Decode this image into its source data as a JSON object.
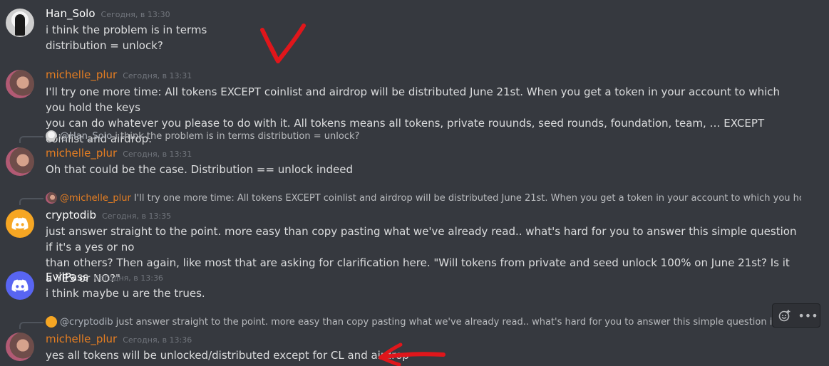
{
  "messages": [
    {
      "author": "Han_Solo",
      "timestamp": "Сегодня, в 13:30",
      "lines": [
        "i think the problem is in terms",
        "distribution = unlock?"
      ],
      "avatar_icon": "han-solo-avatar"
    },
    {
      "author": "michelle_plur",
      "timestamp": "Сегодня, в 13:31",
      "lines": [
        "I'll try one more time: All tokens EXCEPT coinlist and airdrop will be distributed June 21st. When you get a token in your account to which you hold the keys",
        "you can do whatever you please to do with it. All tokens means all tokens, private rouunds, seed rounds, foundation, team, … EXCEPT coinlist and airdrop."
      ],
      "avatar_icon": "michelle-avatar"
    },
    {
      "reply": {
        "mention": "@Han_Solo",
        "text": "i think the problem is in terms distribution = unlock?"
      },
      "author": "michelle_plur",
      "timestamp": "Сегодня, в 13:31",
      "lines": [
        "Oh that could be the case. Distribution == unlock indeed"
      ],
      "avatar_icon": "michelle-avatar"
    },
    {
      "reply": {
        "mention": "@michelle_plur",
        "text": "I'll try one more time: All tokens EXCEPT coinlist and airdrop will be distributed June 21st. When you get a token in your account to which you hold the keys you …"
      },
      "author": "cryptodib",
      "timestamp": "Сегодня, в 13:35",
      "lines": [
        "just answer straight to the point. more easy than copy pasting what we've already read.. what's hard for you to answer this simple question if it's a yes or no",
        "than others? Then again, like most that are asking for clarification here. \"Will tokens from private and seed unlock 100% on June 21st? Is it a YES or NO?\""
      ],
      "avatar_icon": "discord-default-avatar-orange"
    },
    {
      "author": "EvilPass",
      "timestamp": "Сегодня, в 13:36",
      "lines": [
        "i think maybe u are the trues."
      ],
      "avatar_icon": "discord-default-avatar-blue"
    },
    {
      "reply": {
        "mention": "@cryptodib",
        "text": "just answer straight to the point. more easy than copy pasting what we've already read.. what's hard for you to answer this simple question if it's a yes or no than o"
      },
      "author": "michelle_plur",
      "timestamp": "Сегодня, в 13:36",
      "lines": [
        "yes all tokens will be unlocked/distributed except for CL and airdrop"
      ],
      "avatar_icon": "michelle-avatar"
    }
  ],
  "toolbar": {
    "add_reaction_icon": "add-reaction-icon",
    "more_icon": "more-options-icon",
    "more_glyph": "•••"
  },
  "annotations": {
    "arrow_color": "#e0161b"
  },
  "colors": {
    "background": "#36393f",
    "orange_name": "#e67e22",
    "text": "#dcddde",
    "timestamp": "#72767d"
  }
}
